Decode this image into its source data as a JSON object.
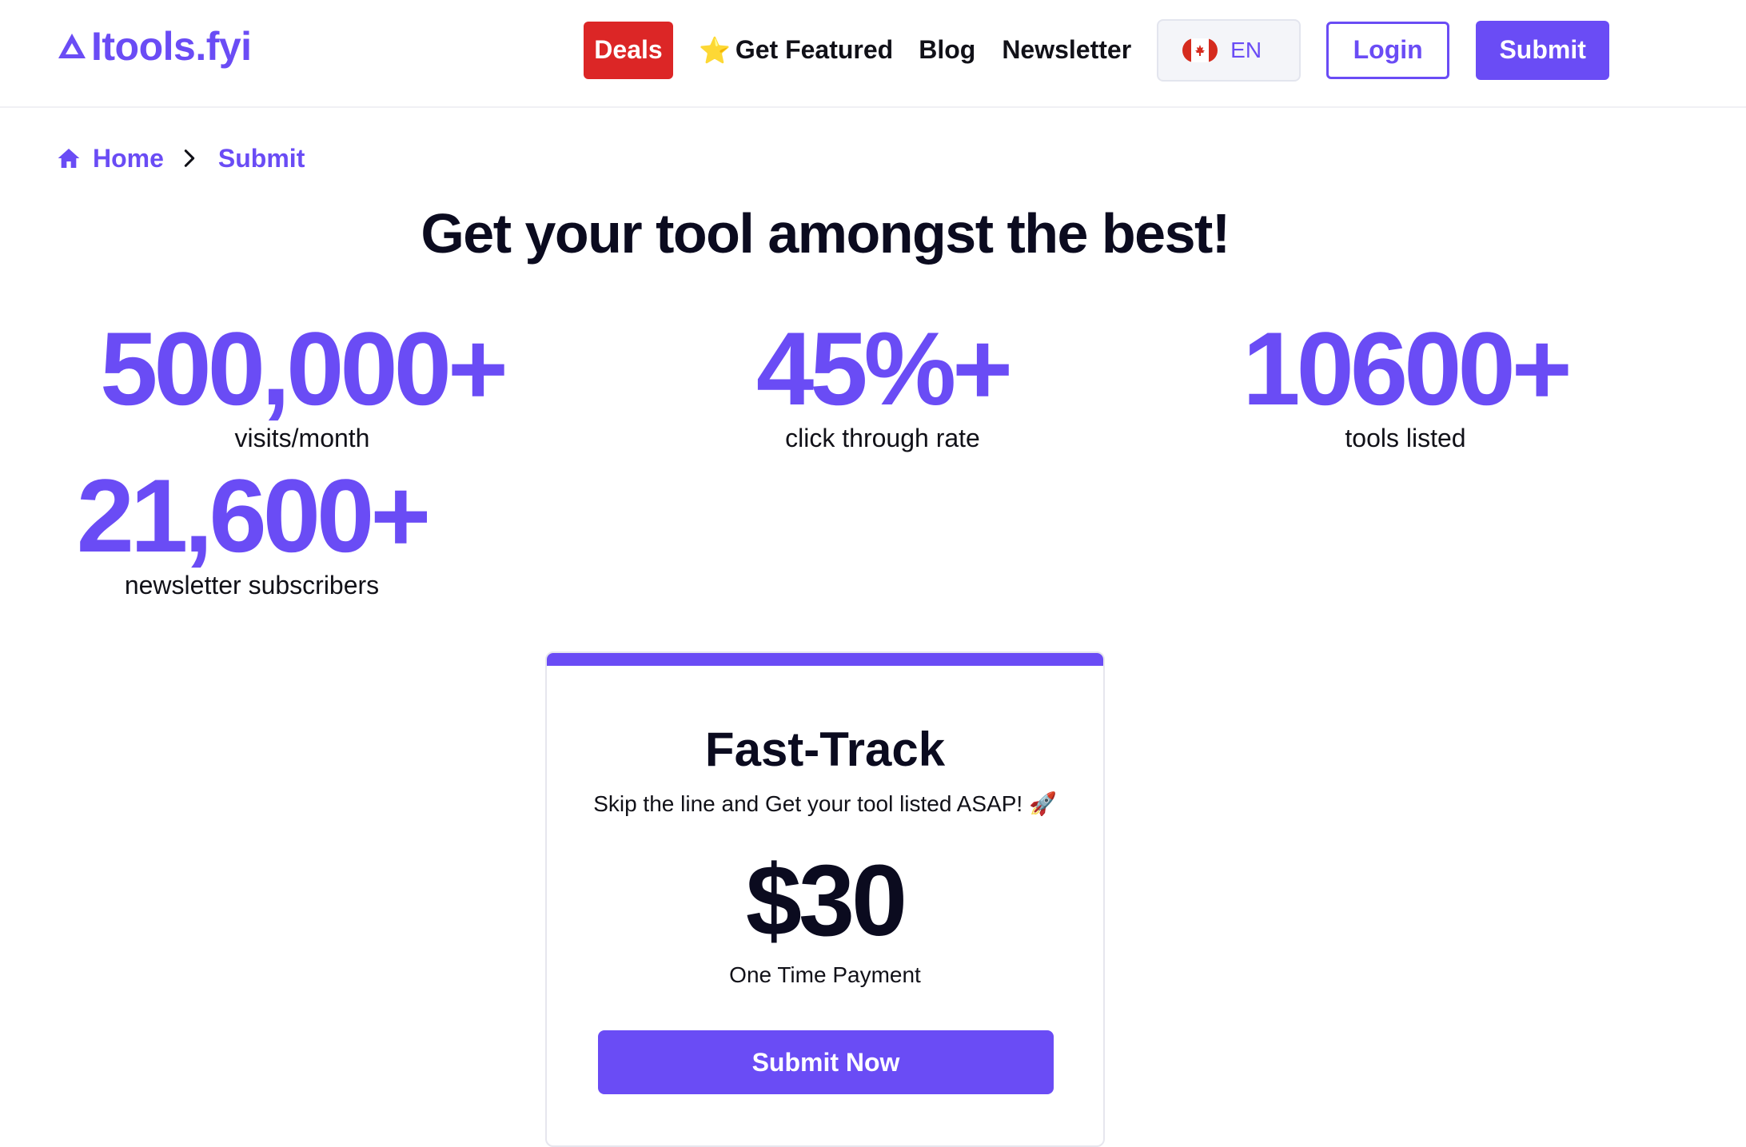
{
  "brand": {
    "logo_text": "Itools.fyi",
    "accent": "#6a4cf5"
  },
  "nav": {
    "deals": "Deals",
    "deals_color": "#dc2626",
    "get_featured": "Get Featured",
    "get_featured_icon": "star-icon",
    "blog": "Blog",
    "newsletter": "Newsletter",
    "language": {
      "flag": "canada-flag-icon",
      "label": "EN"
    },
    "login": "Login",
    "submit": "Submit"
  },
  "breadcrumb": {
    "home": "Home",
    "current": "Submit"
  },
  "page": {
    "title": "Get your tool amongst the best!"
  },
  "stats": [
    {
      "value": "500,000+",
      "label": "visits/month"
    },
    {
      "value": "45%+",
      "label": "click through rate"
    },
    {
      "value": "10600+",
      "label": "tools listed"
    },
    {
      "value": "21,600+",
      "label": "newsletter subscribers"
    }
  ],
  "pricing_card": {
    "title": "Fast-Track",
    "description": "Skip the line and Get your tool listed ASAP! 🚀",
    "price": "$30",
    "price_note": "One Time Payment",
    "cta": "Submit Now"
  }
}
